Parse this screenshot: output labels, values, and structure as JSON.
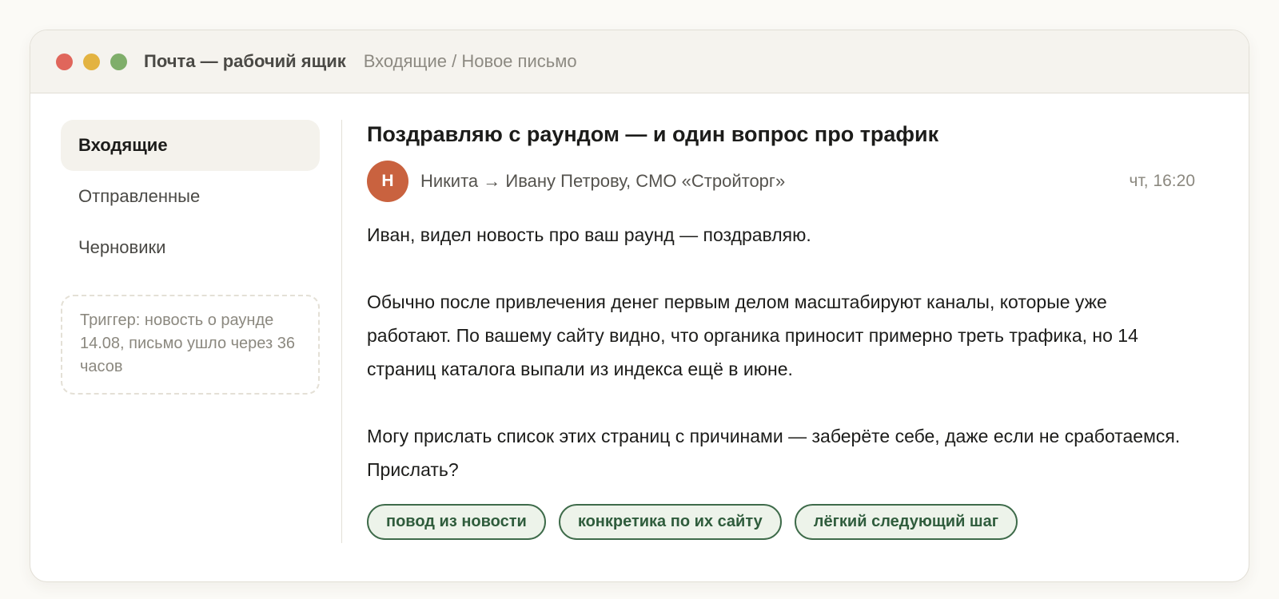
{
  "window": {
    "title": "Почта — рабочий ящик",
    "breadcrumb": "Входящие / Новое письмо"
  },
  "sidebar": {
    "items": [
      {
        "label": "Входящие",
        "active": true
      },
      {
        "label": "Отправленные",
        "active": false
      },
      {
        "label": "Черновики",
        "active": false
      }
    ],
    "note": "Триггер: новость о раунде 14.08, письмо ушло через 36 часов"
  },
  "email": {
    "subject": "Поздравляю с раундом — и один вопрос про трафик",
    "avatar_initial": "Н",
    "route": "Никита → Ивану Петрову, CMO «Стройторг»",
    "time": "чт, 16:20",
    "paragraphs": [
      "Иван, видел новость про ваш раунд — поздравляю.",
      "Обычно после привлечения денег первым делом масштабируют каналы, которые уже работают. По вашему сайту видно, что органика приносит примерно треть трафика, но 14 страниц каталога выпали из индекса ещё в июне.",
      "Могу прислать список этих страниц с причинами — заберёте себе, даже если не сработаемся. Прислать?"
    ],
    "tags": [
      "повод из новости",
      "конкретика по их сайту",
      "лёгкий следующий шаг"
    ]
  },
  "colors": {
    "accent_avatar": "#c9623f",
    "tag_green": "#2f5c3c",
    "tag_bg": "#edf3ea",
    "dot_red": "#e0665b",
    "dot_yellow": "#e3b341",
    "dot_green": "#7fae6a"
  }
}
